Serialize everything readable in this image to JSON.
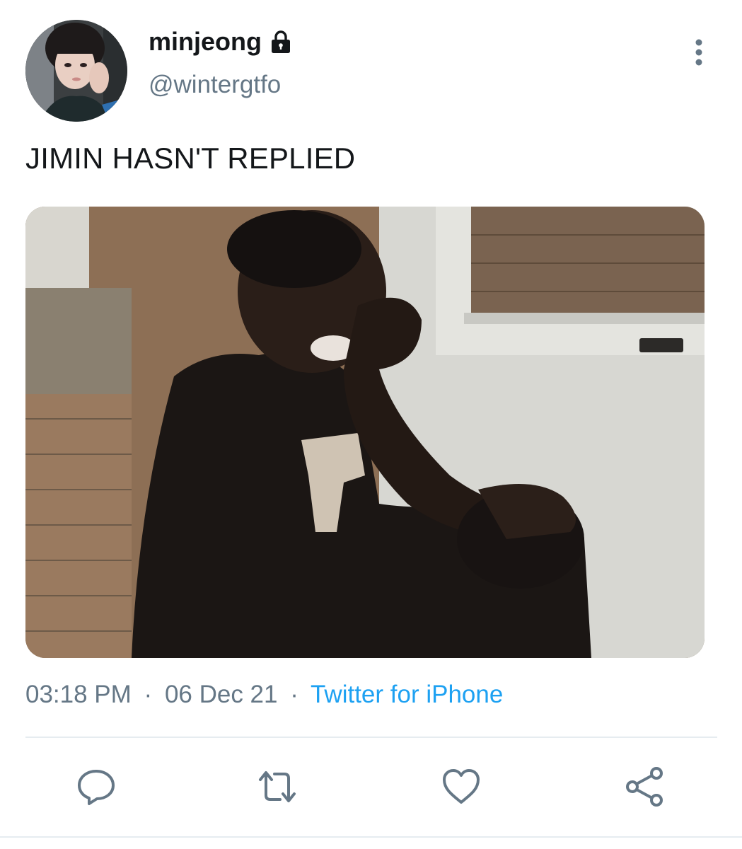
{
  "user": {
    "display_name": "minjeong",
    "handle": "@wintergtfo",
    "protected": true
  },
  "tweet": {
    "text": "JIMIN HASN'T REPLIED",
    "media_alt": "crying kid meme"
  },
  "meta": {
    "time": "03:18 PM",
    "separator": "·",
    "date": "06 Dec 21",
    "source": "Twitter for iPhone"
  },
  "icons": {
    "lock": "lock-icon",
    "more": "more-vertical-icon",
    "reply": "reply-icon",
    "retweet": "retweet-icon",
    "like": "heart-icon",
    "share": "share-icon"
  },
  "colors": {
    "text": "#14171a",
    "secondary": "#657786",
    "link": "#1da1f2",
    "divider": "#e6ecf0"
  }
}
